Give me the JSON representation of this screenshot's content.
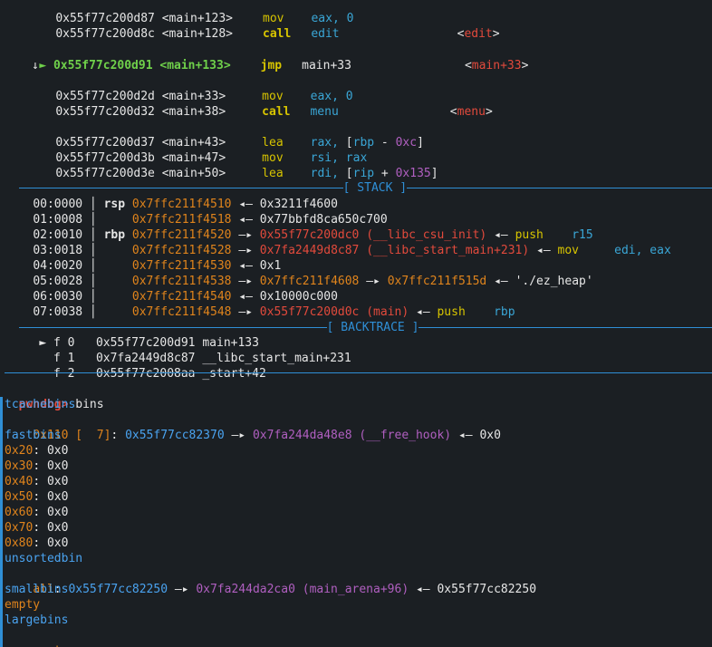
{
  "disasm": [
    {
      "addr": "0x55f77c200d87",
      "sym": "<main+123>",
      "mnem": "mov",
      "ops": "eax, 0",
      "target": ""
    },
    {
      "addr": "0x55f77c200d8c",
      "sym": "<main+128>",
      "mnem": "call",
      "ops": "edit",
      "target": "<edit>"
    },
    {
      "addr": "0x55f77c200d91",
      "sym": "<main+133>",
      "mnem": "jmp",
      "ops": "main+33",
      "target": "<main+33>",
      "current": true
    },
    {
      "addr": "0x55f77c200d2d",
      "sym": "<main+33>",
      "mnem": "mov",
      "ops": "eax, 0",
      "target": ""
    },
    {
      "addr": "0x55f77c200d32",
      "sym": "<main+38>",
      "mnem": "call",
      "ops": "menu",
      "target": "<menu>"
    },
    {
      "addr": "0x55f77c200d37",
      "sym": "<main+43>",
      "mnem": "lea",
      "ops": "rax, [rbp - 0xc]",
      "target": ""
    },
    {
      "addr": "0x55f77c200d3b",
      "sym": "<main+47>",
      "mnem": "mov",
      "ops": "rsi, rax",
      "target": ""
    },
    {
      "addr": "0x55f77c200d3e",
      "sym": "<main+50>",
      "mnem": "lea",
      "ops": "rdi, [rip + 0x135]",
      "target": ""
    }
  ],
  "current_marker": "►",
  "down_arrow": "↓",
  "stack_title": "[ STACK ]",
  "backtrace_title": "[ BACKTRACE ]",
  "stack": [
    {
      "off": "00:0000",
      "reg": "rsp",
      "addr": "0x7ffc211f4510",
      "arrow": "◂—",
      "v1": "0x3211f4600",
      "v1c": "white",
      "rest": ""
    },
    {
      "off": "01:0008",
      "reg": "",
      "addr": "0x7ffc211f4518",
      "arrow": "◂—",
      "v1": "0x77bbfd8ca650c700",
      "v1c": "white",
      "rest": ""
    },
    {
      "off": "02:0010",
      "reg": "rbp",
      "addr": "0x7ffc211f4520",
      "arrow": "—▸",
      "v1": "0x55f77c200dc0 (__libc_csu_init)",
      "v1c": "red",
      "arrow2": "◂—",
      "ins": "push",
      "insops": "r15"
    },
    {
      "off": "03:0018",
      "reg": "",
      "addr": "0x7ffc211f4528",
      "arrow": "—▸",
      "v1": "0x7fa2449d8c87 (__libc_start_main+231)",
      "v1c": "red",
      "arrow2": "◂—",
      "ins": "mov",
      "insops": "edi, eax"
    },
    {
      "off": "04:0020",
      "reg": "",
      "addr": "0x7ffc211f4530",
      "arrow": "◂—",
      "v1": "0x1",
      "v1c": "white",
      "rest": ""
    },
    {
      "off": "05:0028",
      "reg": "",
      "addr": "0x7ffc211f4538",
      "arrow": "—▸",
      "v1": "0x7ffc211f4608",
      "v1c": "orange",
      "arrow2": "—▸",
      "v2": "0x7ffc211f515d",
      "arrow3": "◂—",
      "str": "'./ez_heap'"
    },
    {
      "off": "06:0030",
      "reg": "",
      "addr": "0x7ffc211f4540",
      "arrow": "◂—",
      "v1": "0x10000c000",
      "v1c": "white",
      "rest": ""
    },
    {
      "off": "07:0038",
      "reg": "",
      "addr": "0x7ffc211f4548",
      "arrow": "—▸",
      "v1": "0x55f77c200d0c (main)",
      "v1c": "red",
      "arrow2": "◂—",
      "ins": "push",
      "insops": "rbp"
    }
  ],
  "backtrace": [
    {
      "marker": "►",
      "frame": "f 0",
      "addr": "0x55f77c200d91",
      "sym": "main+133"
    },
    {
      "marker": "",
      "frame": "f 1",
      "addr": "0x7fa2449d8c87",
      "sym": "__libc_start_main+231"
    },
    {
      "marker": "",
      "frame": "f 2",
      "addr": "0x55f77c2008aa",
      "sym": "_start+42"
    }
  ],
  "prompt": "pwndbg>",
  "command": "bins",
  "bins": {
    "tcache_label": "tcachebins",
    "tcache_size": "0x110",
    "tcache_count": "[  7]",
    "tcache_ptr": "0x55f77cc82370",
    "tcache_ptr2": "0x7fa244da48e8 (__free_hook)",
    "tcache_end": "0x0",
    "fast_label": "fastbins",
    "fast": [
      {
        "size": "0x20",
        "val": "0x0"
      },
      {
        "size": "0x30",
        "val": "0x0"
      },
      {
        "size": "0x40",
        "val": "0x0"
      },
      {
        "size": "0x50",
        "val": "0x0"
      },
      {
        "size": "0x60",
        "val": "0x0"
      },
      {
        "size": "0x70",
        "val": "0x0"
      },
      {
        "size": "0x80",
        "val": "0x0"
      }
    ],
    "unsorted_label": "unsortedbin",
    "unsorted_all": "all",
    "unsorted_ptr": "0x55f77cc82250",
    "unsorted_ptr2": "0x7fa244da2ca0 (main_arena+96)",
    "unsorted_end": "0x55f77cc82250",
    "small_label": "smallbins",
    "small_val": "empty",
    "large_label": "largebins",
    "large_val": "empty"
  }
}
